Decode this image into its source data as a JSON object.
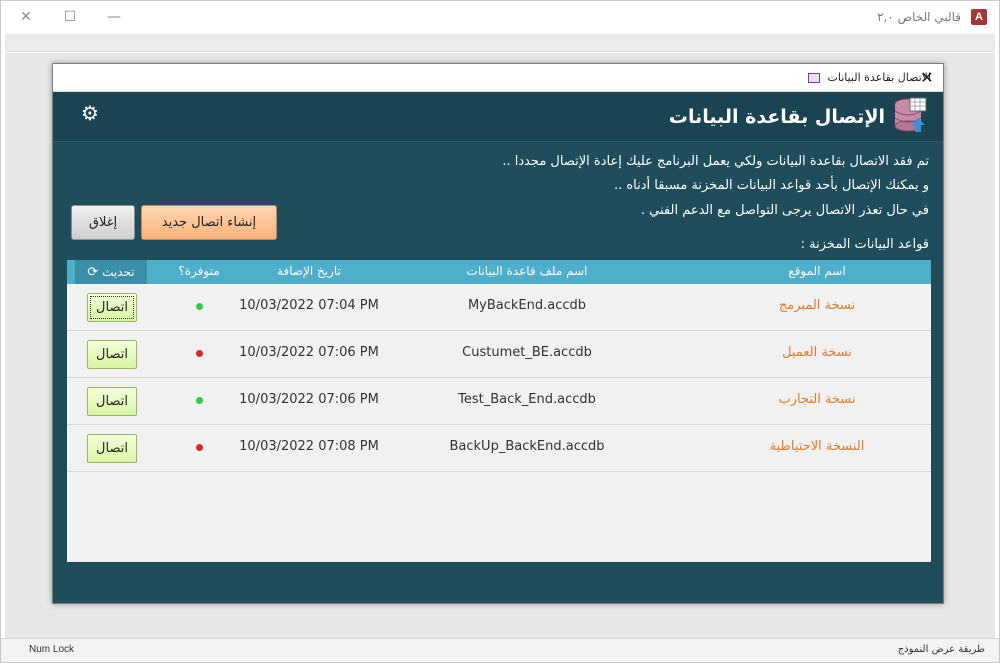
{
  "app": {
    "title": "قالبي الخاص ٢,٠",
    "icon_letter": "A",
    "status_left": "Num Lock",
    "status_right": "طريقة عرض النموذج"
  },
  "dialog": {
    "title": "الاتصال بقاعدة البيانات",
    "header_title": "الإتصال بقاعدة البيانات",
    "message_1": "تم فقد الاتصال بقاعدة البيانات ولكي يعمل البرنامج عليك إعادة الإتصال مجددا ..",
    "message_2": "و يمكنك الإتصال بأحد قواعد البيانات المخزنة مسبقا أدناه ..",
    "message_3": "في حال تعذر الاتصال يرجى التواصل مع الدعم الفني .",
    "stored_label": "قواعد البيانات المخزنة :",
    "new_connection_label": "إنشاء اتصال جديد",
    "close_label": "إغلاق"
  },
  "table": {
    "headers": {
      "site": "اسم الموقع",
      "file": "اسم ملف قاعدة البيانات",
      "date": "تاريخ الإضافة",
      "available": "متوفرة؟",
      "refresh": "تحديث"
    },
    "rows": [
      {
        "site": "نسخة المبرمج",
        "file": "MyBackEnd.accdb",
        "date": "10/03/2022 07:04 PM",
        "available": true,
        "status_color": "#2ecc40",
        "connect": "اتصال"
      },
      {
        "site": "نسخة العميل",
        "file": "Custumet_BE.accdb",
        "date": "10/03/2022 07:06 PM",
        "available": false,
        "status_color": "#e0242a",
        "connect": "اتصال"
      },
      {
        "site": "نسخة التجارب",
        "file": "Test_Back_End.accdb",
        "date": "10/03/2022 07:06 PM",
        "available": true,
        "status_color": "#2ecc40",
        "connect": "اتصال"
      },
      {
        "site": "النسخة الاحتياطية",
        "file": "BackUp_BackEnd.accdb",
        "date": "10/03/2022 07:08 PM",
        "available": false,
        "status_color": "#e0242a",
        "connect": "اتصال"
      }
    ]
  },
  "colors": {
    "dialog_bg": "#1f4d5b",
    "header_band": "#1b4452",
    "table_header": "#4faec9",
    "site_text": "#e07b2e",
    "new_button": "#f9b27b",
    "connect_button": "#d9f5a3"
  }
}
